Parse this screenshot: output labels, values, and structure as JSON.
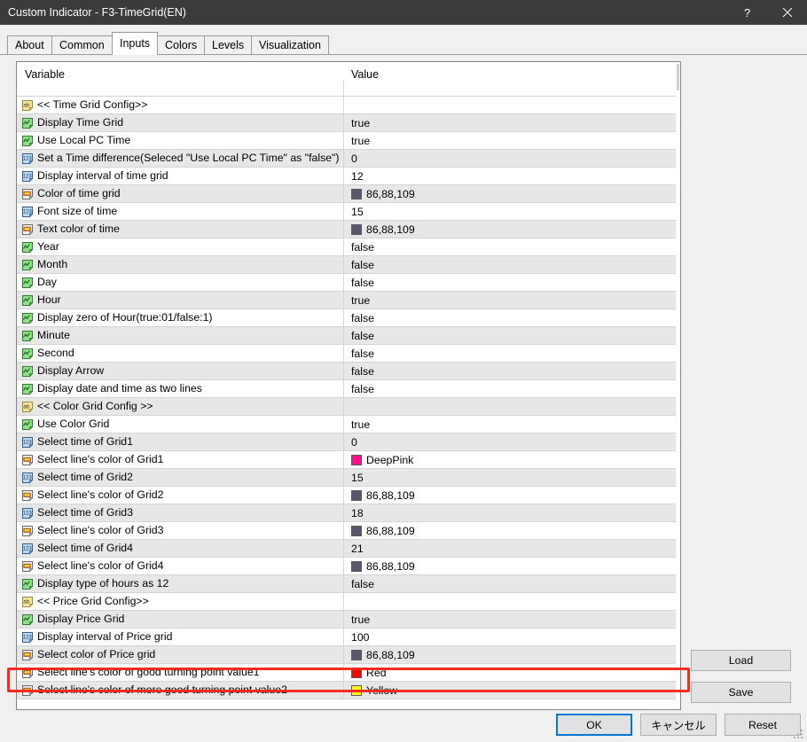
{
  "window": {
    "title": "Custom Indicator - F3-TimeGrid(EN)",
    "help_label": "?",
    "close_label": "×"
  },
  "tabs": [
    {
      "label": "About",
      "active": false
    },
    {
      "label": "Common",
      "active": false
    },
    {
      "label": "Inputs",
      "active": true
    },
    {
      "label": "Colors",
      "active": false
    },
    {
      "label": "Levels",
      "active": false
    },
    {
      "label": "Visualization",
      "active": false
    }
  ],
  "grid": {
    "headers": {
      "variable": "Variable",
      "value": "Value"
    },
    "rows": [
      {
        "icon": "string-param-icon",
        "label": "<< Time Grid Config>>",
        "value": "",
        "type": "text"
      },
      {
        "icon": "boolean-param-icon",
        "label": "Display Time Grid",
        "value": "true",
        "type": "text"
      },
      {
        "icon": "boolean-param-icon",
        "label": "Use Local PC Time",
        "value": "true",
        "type": "text"
      },
      {
        "icon": "integer-param-icon",
        "label": "Set a Time difference(Seleced \"Use Local PC Time\" as \"false\")",
        "value": "0",
        "type": "text"
      },
      {
        "icon": "integer-param-icon",
        "label": "Display interval of time grid",
        "value": "12",
        "type": "text"
      },
      {
        "icon": "color-param-icon",
        "label": "Color of time grid",
        "value": "86,88,109",
        "type": "color",
        "swatch": "#56586d"
      },
      {
        "icon": "integer-param-icon",
        "label": "Font size of time",
        "value": "15",
        "type": "text"
      },
      {
        "icon": "color-param-icon",
        "label": "Text color of time",
        "value": "86,88,109",
        "type": "color",
        "swatch": "#56586d"
      },
      {
        "icon": "boolean-param-icon",
        "label": "Year",
        "value": "false",
        "type": "text"
      },
      {
        "icon": "boolean-param-icon",
        "label": "Month",
        "value": "false",
        "type": "text"
      },
      {
        "icon": "boolean-param-icon",
        "label": "Day",
        "value": "false",
        "type": "text"
      },
      {
        "icon": "boolean-param-icon",
        "label": "Hour",
        "value": "true",
        "type": "text"
      },
      {
        "icon": "boolean-param-icon",
        "label": "Display zero of Hour(true:01/false:1)",
        "value": "false",
        "type": "text"
      },
      {
        "icon": "boolean-param-icon",
        "label": "Minute",
        "value": "false",
        "type": "text"
      },
      {
        "icon": "boolean-param-icon",
        "label": "Second",
        "value": "false",
        "type": "text"
      },
      {
        "icon": "boolean-param-icon",
        "label": "Display Arrow",
        "value": "false",
        "type": "text"
      },
      {
        "icon": "boolean-param-icon",
        "label": "Display date and time as two lines",
        "value": "false",
        "type": "text"
      },
      {
        "icon": "string-param-icon",
        "label": "<< Color Grid Config >>",
        "value": "",
        "type": "text"
      },
      {
        "icon": "boolean-param-icon",
        "label": "Use Color Grid",
        "value": "true",
        "type": "text"
      },
      {
        "icon": "integer-param-icon",
        "label": "Select time of Grid1",
        "value": "0",
        "type": "text"
      },
      {
        "icon": "color-param-icon",
        "label": "Select line's color of Grid1",
        "value": "DeepPink",
        "type": "color",
        "swatch": "#ff0f8f"
      },
      {
        "icon": "integer-param-icon",
        "label": "Select time of Grid2",
        "value": "15",
        "type": "text"
      },
      {
        "icon": "color-param-icon",
        "label": "Select line's color of Grid2",
        "value": "86,88,109",
        "type": "color",
        "swatch": "#56586d"
      },
      {
        "icon": "integer-param-icon",
        "label": "Select time of Grid3",
        "value": "18",
        "type": "text"
      },
      {
        "icon": "color-param-icon",
        "label": "Select line's color of Grid3",
        "value": "86,88,109",
        "type": "color",
        "swatch": "#56586d"
      },
      {
        "icon": "integer-param-icon",
        "label": "Select time of Grid4",
        "value": "21",
        "type": "text"
      },
      {
        "icon": "color-param-icon",
        "label": "Select line's color of Grid4",
        "value": "86,88,109",
        "type": "color",
        "swatch": "#56586d"
      },
      {
        "icon": "boolean-param-icon",
        "label": "Display type of hours as 12",
        "value": "false",
        "type": "text"
      },
      {
        "icon": "string-param-icon",
        "label": "<< Price Grid Config>>",
        "value": "",
        "type": "text"
      },
      {
        "icon": "boolean-param-icon",
        "label": "Display Price Grid",
        "value": "true",
        "type": "text"
      },
      {
        "icon": "integer-param-icon",
        "label": "Display interval of Price grid",
        "value": "100",
        "type": "text",
        "highlighted": true
      },
      {
        "icon": "color-param-icon",
        "label": "Select color of Price grid",
        "value": "86,88,109",
        "type": "color",
        "swatch": "#56586d"
      },
      {
        "icon": "color-param-icon",
        "label": "Select line's color of good turning point value1",
        "value": "Red",
        "type": "color",
        "swatch": "#fb0000"
      },
      {
        "icon": "color-param-icon",
        "label": "Select line's color of more good turning point value2",
        "value": "Yellow",
        "type": "color",
        "swatch": "#ffff00"
      }
    ]
  },
  "side_buttons": {
    "load_label": "Load",
    "save_label": "Save"
  },
  "bottom_buttons": {
    "ok_label": "OK",
    "cancel_label": "キャンセル",
    "reset_label": "Reset"
  },
  "annotation": {
    "highlight_color": "#fa2a20",
    "highlighted_row_label": "Display interval of Price grid"
  }
}
